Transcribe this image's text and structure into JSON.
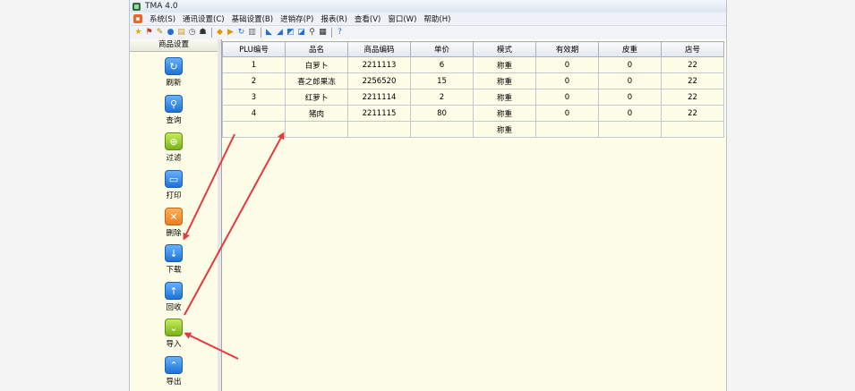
{
  "window": {
    "title": "TMA 4.0"
  },
  "menu": [
    "系统(S)",
    "通讯设置(C)",
    "基础设置(B)",
    "进销存(P)",
    "报表(R)",
    "查看(V)",
    "窗口(W)",
    "帮助(H)"
  ],
  "toolbar_icons": [
    "star-icon",
    "antenna-icon",
    "wrench-icon",
    "globe-icon",
    "document-icon",
    "clock-icon",
    "people-icon",
    "diamond-icon",
    "play-icon",
    "refresh-icon",
    "book-icon",
    "scale-left-icon",
    "scale-right-icon",
    "scale-print-icon",
    "scale-blue-icon",
    "walk-icon",
    "qr-icon",
    "help-icon"
  ],
  "sidebar": {
    "title": "商品设置",
    "items": [
      {
        "label": "刷新",
        "icon": "refresh-icon",
        "color": "#1d72d9"
      },
      {
        "label": "查询",
        "icon": "search-icon",
        "color": "#1d72d9"
      },
      {
        "label": "过滤",
        "icon": "globe-filter-icon",
        "color": "#78b418"
      },
      {
        "label": "打印",
        "icon": "print-icon",
        "color": "#1d72d9"
      },
      {
        "label": "删除",
        "icon": "delete-icon",
        "color": "#f07a1f"
      },
      {
        "label": "下载",
        "icon": "arrow-down-icon",
        "color": "#1d72d9"
      },
      {
        "label": "回收",
        "icon": "arrow-up-icon",
        "color": "#1d72d9"
      },
      {
        "label": "导入",
        "icon": "double-chevron-down-icon",
        "color": "#78b418"
      },
      {
        "label": "导出",
        "icon": "double-chevron-up-icon",
        "color": "#1d72d9"
      }
    ]
  },
  "table": {
    "columns": [
      "PLU编号",
      "品名",
      "商品编码",
      "单价",
      "模式",
      "有效期",
      "皮重",
      "店号"
    ],
    "rows": [
      [
        "1",
        "白萝卜",
        "2211113",
        "6",
        "称重",
        "0",
        "0",
        "22"
      ],
      [
        "2",
        "喜之郎果冻",
        "2256520",
        "15",
        "称重",
        "0",
        "0",
        "22"
      ],
      [
        "3",
        "红萝卜",
        "2211114",
        "2",
        "称重",
        "0",
        "0",
        "22"
      ],
      [
        "4",
        "猪肉",
        "2211115",
        "80",
        "称重",
        "0",
        "0",
        "22"
      ],
      [
        "",
        "",
        "",
        "",
        "称重",
        "",
        "",
        ""
      ]
    ]
  },
  "colors": {
    "annotation_arrow": "#e8383d",
    "panel_bg": "#fdfde8"
  }
}
